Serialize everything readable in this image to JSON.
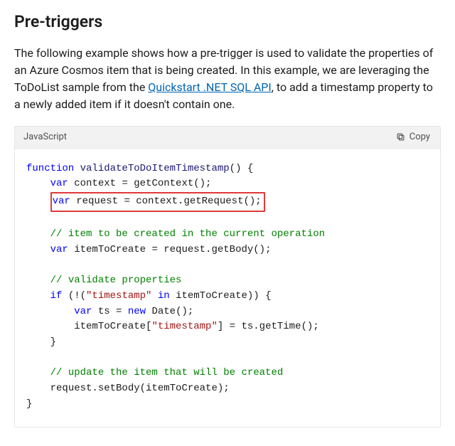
{
  "heading": "Pre-triggers",
  "intro": {
    "before_link": "The following example shows how a pre-trigger is used to validate the properties of an Azure Cosmos item that is being created. In this example, we are leveraging the ToDoList sample from the ",
    "link_text": "Quickstart .NET SQL API",
    "after_link": ", to add a timestamp property to a newly added item if it doesn't contain one."
  },
  "codebox": {
    "language": "JavaScript",
    "copy_label": "Copy"
  },
  "code": {
    "kw_function": "function",
    "fn_name": "validateToDoItemTimestamp",
    "fn_open": "() {",
    "kw_var1": "var",
    "l2_rest": " context = getContext();",
    "hl_var": "var",
    "hl_rest": " request = context.getRequest();",
    "cm_item": "// item to be created in the current operation",
    "kw_var2": "var",
    "l5_rest": " itemToCreate = request.getBody();",
    "cm_validate": "// validate properties",
    "kw_if": "if",
    "l7_a": " (!(",
    "str_ts1": "\"timestamp\"",
    "kw_in": "in",
    "l7_c": " itemToCreate)) {",
    "kw_var3": "var",
    "l8_a": " ts = ",
    "kw_new": "new",
    "l8_c": " Date();",
    "l9_a": "itemToCreate[",
    "str_ts2": "\"timestamp\"",
    "l9_b": "] = ts.getTime();",
    "brace_close1": "}",
    "cm_update": "// update the item that will be created",
    "l12": "request.setBody(itemToCreate);",
    "brace_close2": "}"
  }
}
